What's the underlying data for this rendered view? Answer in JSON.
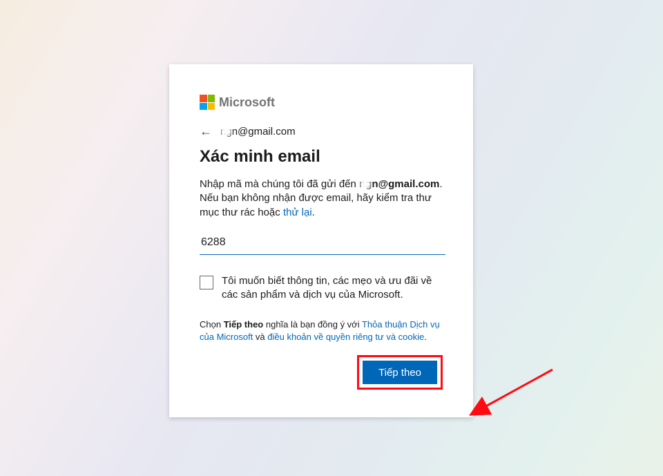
{
  "logo_text": "Microsoft",
  "email_prefix_hidden": "ng",
  "email_suffix": "n@gmail.com",
  "title": "Xác minh email",
  "body_before": "Nhập mã mà chúng tôi đã gửi đến",
  "body_email_prefix_hidden": "ng",
  "body_email_suffix": "n@gmail.com",
  "body_after1": ". Nếu bạn không nhận được email, hãy kiểm tra thư mục thư rác hoặc ",
  "body_link_try": "thử lại",
  "body_after2": ".",
  "code_value": "6288",
  "optin_text": "Tôi muốn biết thông tin, các mẹo và ưu đãi về các sản phẩm và dịch vụ của Microsoft.",
  "legal_before": "Chọn ",
  "legal_bold": "Tiếp theo",
  "legal_mid": " nghĩa là bạn đồng ý với ",
  "legal_link1": "Thỏa thuận Dịch vụ của Microsoft",
  "legal_and": " và ",
  "legal_link2": "điều khoản về quyền riêng tư và cookie",
  "legal_end": ".",
  "next_label": "Tiếp theo"
}
